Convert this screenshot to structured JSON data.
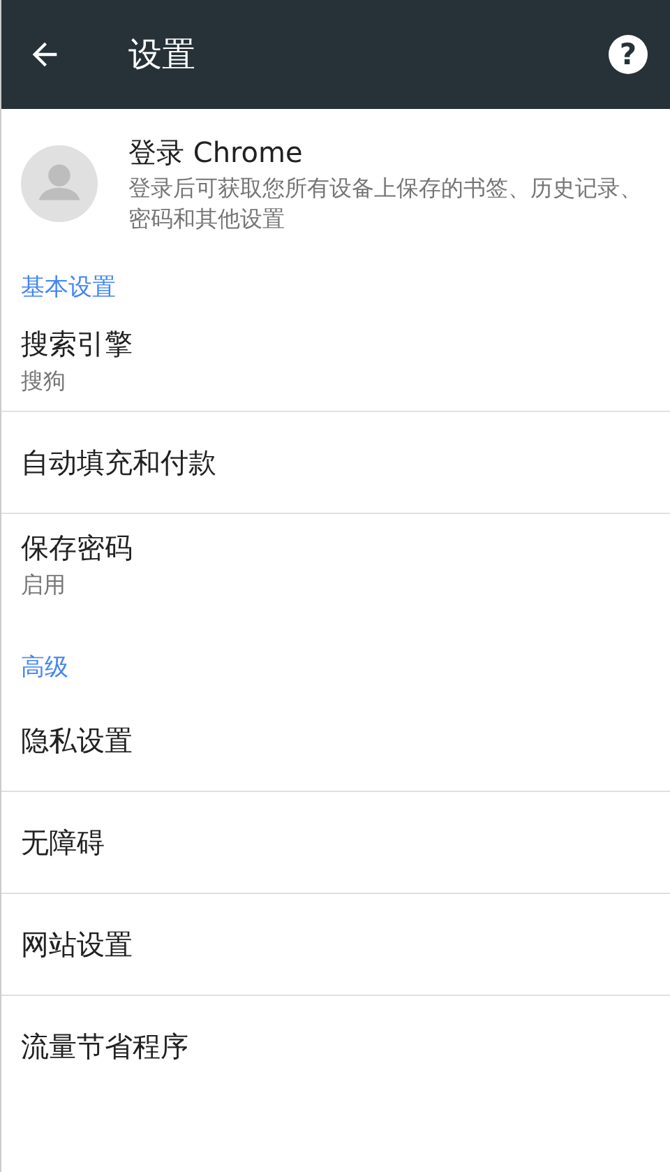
{
  "app_bar": {
    "title": "设置",
    "help": "?"
  },
  "account": {
    "title": "登录 Chrome",
    "description": "登录后可获取您所有设备上保存的书签、历史记录、密码和其他设置"
  },
  "list": [
    {
      "kind": "section",
      "title": "基本设置"
    },
    {
      "kind": "item",
      "title": "搜索引擎",
      "subtitle": "搜狗"
    },
    {
      "kind": "item",
      "title": "自动填充和付款"
    },
    {
      "kind": "item",
      "title": "保存密码",
      "subtitle": "启用"
    },
    {
      "kind": "section",
      "title": "高级"
    },
    {
      "kind": "item",
      "title": "隐私设置"
    },
    {
      "kind": "item",
      "title": "无障碍"
    },
    {
      "kind": "item",
      "title": "网站设置"
    },
    {
      "kind": "item",
      "title": "流量节省程序"
    }
  ]
}
